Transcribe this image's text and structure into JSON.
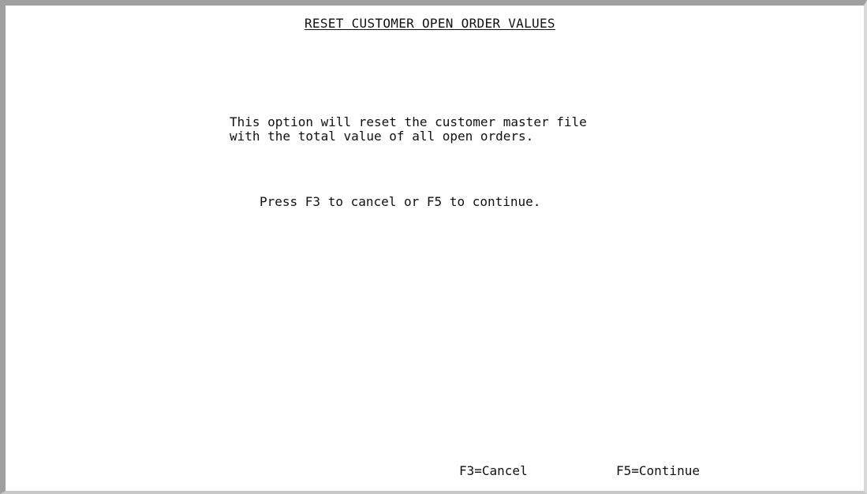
{
  "screen": {
    "title": "RESET CUSTOMER OPEN ORDER VALUES",
    "message_line_1": "This option will reset the customer master file",
    "message_line_2": "with the total value of all open orders.",
    "prompt": "Press F3 to cancel or F5 to continue."
  },
  "function_keys": {
    "cancel": "F3=Cancel",
    "continue": "F5=Continue"
  }
}
